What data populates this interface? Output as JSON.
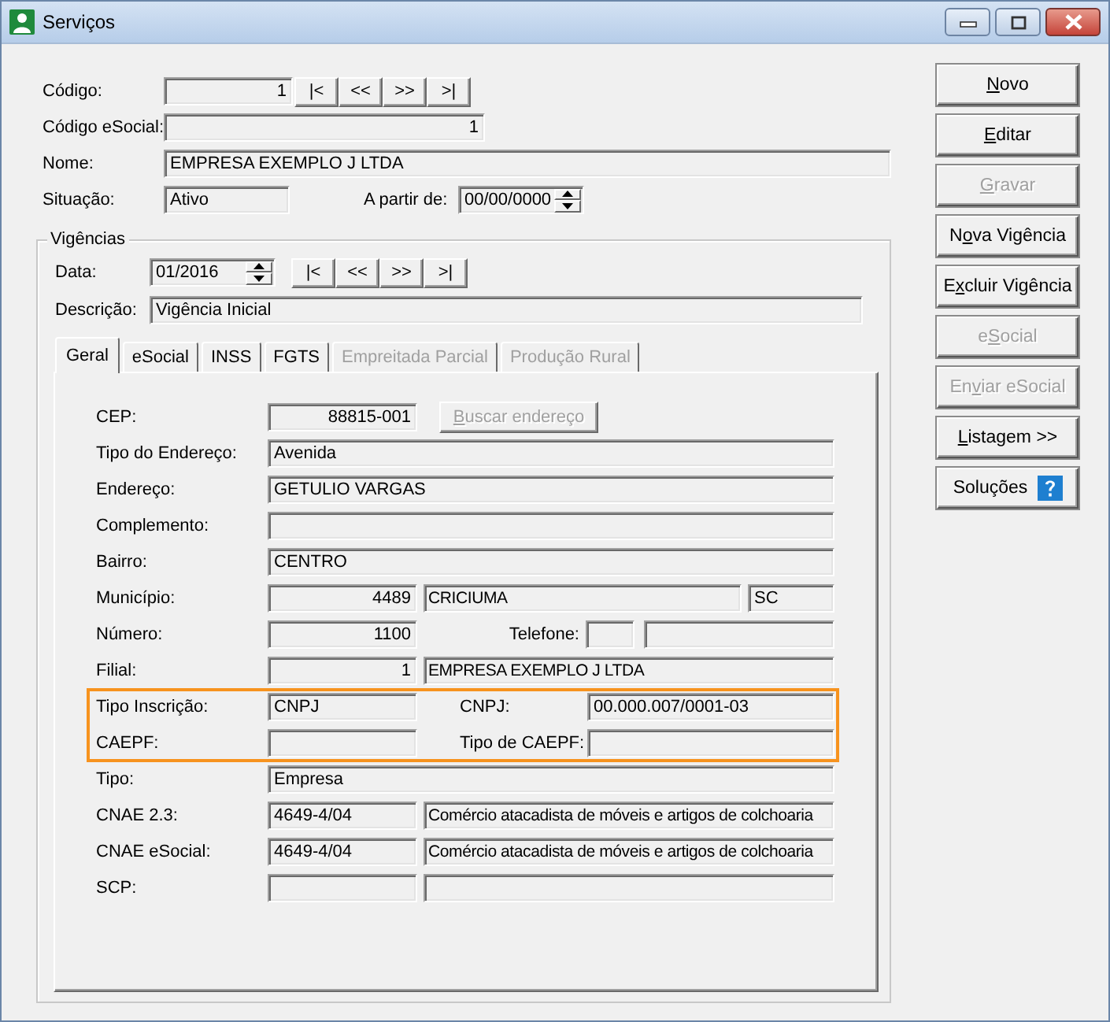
{
  "window": {
    "title": "Serviços"
  },
  "form": {
    "rows": [
      {
        "items": [
          {
            "kind": "label",
            "text": "Código:"
          },
          {
            "kind": "code",
            "value": "1"
          },
          {
            "kind": "nav",
            "buttons": [
              "|<",
              "<<",
              ">>",
              ">|"
            ]
          }
        ]
      },
      {
        "items": [
          {
            "kind": "label",
            "text": "Código eSocial:"
          },
          {
            "kind": "code-wide",
            "value": "1"
          }
        ]
      },
      {
        "items": [
          {
            "kind": "label",
            "text": "Nome:"
          },
          {
            "kind": "wide",
            "value": "EMPRESA EXEMPLO J LTDA"
          }
        ]
      },
      {
        "items": [
          {
            "kind": "label",
            "text": "Situação:"
          },
          {
            "kind": "short",
            "value": "Ativo"
          },
          {
            "kind": "side-label",
            "text": "A partir de:"
          },
          {
            "kind": "date",
            "value": "00/00/0000"
          }
        ]
      }
    ]
  },
  "vigencias": {
    "title": "Vigências",
    "rows": [
      {
        "items": [
          {
            "kind": "label",
            "text": "Data:"
          },
          {
            "kind": "date",
            "value": "01/2016"
          },
          {
            "kind": "nav",
            "buttons": [
              "|<",
              "<<",
              ">>",
              ">|"
            ]
          }
        ]
      },
      {
        "items": [
          {
            "kind": "label",
            "text": "Descrição:"
          },
          {
            "kind": "wide",
            "value": "Vigência Inicial"
          }
        ]
      }
    ],
    "tabs": [
      {
        "label": "Geral",
        "selected": true,
        "disabled": false
      },
      {
        "label": "eSocial",
        "selected": false,
        "disabled": false
      },
      {
        "label": "INSS",
        "selected": false,
        "disabled": false
      },
      {
        "label": "FGTS",
        "selected": false,
        "disabled": false
      },
      {
        "label": "Empreitada Parcial",
        "selected": false,
        "disabled": true
      },
      {
        "label": "Produção Rural",
        "selected": false,
        "disabled": true
      }
    ],
    "sections": [
      {
        "highlighted": false,
        "rows": [
          {
            "items": [
              {
                "kind": "label",
                "text": "CEP:"
              },
              {
                "kind": "code",
                "value": "88815-001"
              },
              {
                "kind": "button",
                "accel": "B",
                "after": "uscar endereço",
                "disabled": true
              }
            ]
          },
          {
            "items": [
              {
                "kind": "label",
                "text": "Tipo do Endereço:"
              },
              {
                "kind": "wide",
                "value": "Avenida"
              }
            ]
          },
          {
            "items": [
              {
                "kind": "label",
                "text": "Endereço:"
              },
              {
                "kind": "wide",
                "value": "GETULIO VARGAS"
              }
            ]
          },
          {
            "items": [
              {
                "kind": "label",
                "text": "Complemento:"
              },
              {
                "kind": "wide"
              }
            ]
          },
          {
            "items": [
              {
                "kind": "label",
                "text": "Bairro:"
              },
              {
                "kind": "wide",
                "value": "CENTRO"
              }
            ]
          },
          {
            "items": [
              {
                "kind": "label",
                "text": "Município:"
              },
              {
                "kind": "code",
                "value": "4489"
              },
              {
                "kind": "desc",
                "value": "CRICIUMA"
              },
              {
                "kind": "uf",
                "value": "SC"
              }
            ]
          },
          {
            "items": [
              {
                "kind": "label",
                "text": "Número:"
              },
              {
                "kind": "code",
                "value": "1100"
              },
              {
                "kind": "side-label-right",
                "text": "Telefone:"
              },
              {
                "kind": "phone-area"
              },
              {
                "kind": "phone"
              }
            ]
          },
          {
            "items": [
              {
                "kind": "label",
                "text": "Filial:"
              },
              {
                "kind": "code",
                "value": "1"
              },
              {
                "kind": "desc",
                "value": "EMPRESA EXEMPLO J LTDA"
              }
            ]
          }
        ]
      },
      {
        "highlighted": true,
        "rows": [
          {
            "items": [
              {
                "kind": "label",
                "text": "Tipo Inscrição:"
              },
              {
                "kind": "code-left",
                "value": "CNPJ"
              },
              {
                "kind": "side-label",
                "text": "CNPJ:"
              },
              {
                "kind": "wide",
                "value": "00.000.007/0001-03"
              }
            ]
          },
          {
            "items": [
              {
                "kind": "label",
                "text": "CAEPF:"
              },
              {
                "kind": "code-left"
              },
              {
                "kind": "side-label",
                "text": "Tipo de CAEPF:"
              },
              {
                "kind": "wide"
              }
            ]
          }
        ]
      },
      {
        "highlighted": false,
        "rows": [
          {
            "items": [
              {
                "kind": "label",
                "text": "Tipo:"
              },
              {
                "kind": "wide",
                "value": "Empresa"
              }
            ]
          },
          {
            "items": [
              {
                "kind": "label",
                "text": "CNAE 2.3:"
              },
              {
                "kind": "code-left",
                "value": "4649-4/04"
              },
              {
                "kind": "desc",
                "value": "Comércio atacadista de móveis e artigos de colchoaria"
              }
            ]
          },
          {
            "items": [
              {
                "kind": "label",
                "text": "CNAE eSocial:"
              },
              {
                "kind": "code-left",
                "value": "4649-4/04"
              },
              {
                "kind": "desc",
                "value": "Comércio atacadista de móveis e artigos de colchoaria"
              }
            ]
          },
          {
            "items": [
              {
                "kind": "label",
                "text": "SCP:"
              },
              {
                "kind": "code-left"
              },
              {
                "kind": "desc"
              }
            ]
          }
        ]
      }
    ]
  },
  "actions": [
    {
      "kind": "plain",
      "accel": "N",
      "after": "ovo",
      "disabled": false
    },
    {
      "kind": "plain",
      "accel": "E",
      "after": "ditar",
      "disabled": false
    },
    {
      "kind": "plain",
      "accel": "G",
      "after": "ravar",
      "disabled": true
    },
    {
      "kind": "plain",
      "before": "N",
      "accel": "o",
      "after": "va Vigência",
      "disabled": false
    },
    {
      "kind": "plain",
      "before": "E",
      "accel": "x",
      "after": "cluir Vigência",
      "disabled": false
    },
    {
      "kind": "plain",
      "before": "e",
      "accel": "S",
      "after": "ocial",
      "disabled": true
    },
    {
      "kind": "plain",
      "before": "En",
      "accel": "v",
      "after": "iar eSocial",
      "disabled": true
    },
    {
      "kind": "plain",
      "accel": "L",
      "after": "istagem >>",
      "disabled": false
    },
    {
      "kind": "help",
      "before": "Soluções",
      "disabled": false
    }
  ]
}
